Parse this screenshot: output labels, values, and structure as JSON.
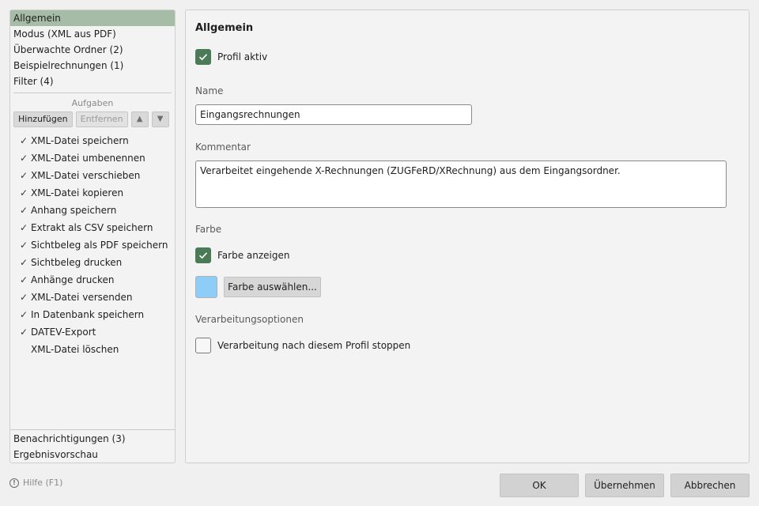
{
  "sidebar": {
    "items": [
      {
        "label": "Allgemein"
      },
      {
        "label": "Modus (XML aus PDF)"
      },
      {
        "label": "Überwachte Ordner (2)"
      },
      {
        "label": "Beispielrechnungen (1)"
      },
      {
        "label": "Filter (4)"
      }
    ],
    "tasks_title": "Aufgaben",
    "toolbar": {
      "add_label": "Hinzufügen",
      "remove_label": "Entfernen",
      "up_label": "▲",
      "down_label": "▼"
    },
    "tasks": [
      {
        "label": "XML-Datei speichern",
        "check": "✓"
      },
      {
        "label": "XML-Datei umbenennen",
        "check": "✓"
      },
      {
        "label": "XML-Datei verschieben",
        "check": "✓"
      },
      {
        "label": "XML-Datei kopieren",
        "check": "✓"
      },
      {
        "label": "Anhang speichern",
        "check": "✓"
      },
      {
        "label": "Extrakt als CSV speichern",
        "check": "✓"
      },
      {
        "label": "Sichtbeleg als PDF speichern",
        "check": "✓"
      },
      {
        "label": "Sichtbeleg drucken",
        "check": "✓"
      },
      {
        "label": "Anhänge drucken",
        "check": "✓"
      },
      {
        "label": "XML-Datei versenden",
        "check": "✓"
      },
      {
        "label": "In Datenbank speichern",
        "check": "✓"
      },
      {
        "label": "DATEV-Export",
        "check": "✓"
      },
      {
        "label": "XML-Datei löschen",
        "check": ""
      }
    ],
    "bottom_items": [
      {
        "label": "Benachrichtigungen (3)"
      },
      {
        "label": "Ergebnisvorschau"
      }
    ]
  },
  "main": {
    "title": "Allgemein",
    "profile_active_label": "Profil aktiv",
    "name_label": "Name",
    "name_value": "Eingangsrechnungen",
    "comment_label": "Kommentar",
    "comment_value": "Verarbeitet eingehende X-Rechnungen (ZUGFeRD/XRechnung) aus dem Eingangsordner.",
    "color_section_label": "Farbe",
    "show_color_label": "Farbe anzeigen",
    "choose_color_label": "Farbe auswählen...",
    "swatch_color": "#8ecdf7",
    "processing_section_label": "Verarbeitungsoptionen",
    "stop_processing_label": "Verarbeitung nach diesem Profil stoppen"
  },
  "footer": {
    "help_label": "Hilfe (F1)",
    "ok_label": "OK",
    "apply_label": "Übernehmen",
    "cancel_label": "Abbrechen"
  },
  "colors": {
    "selection": "#a6bca6",
    "checkbox_checked": "#4a7a56"
  }
}
